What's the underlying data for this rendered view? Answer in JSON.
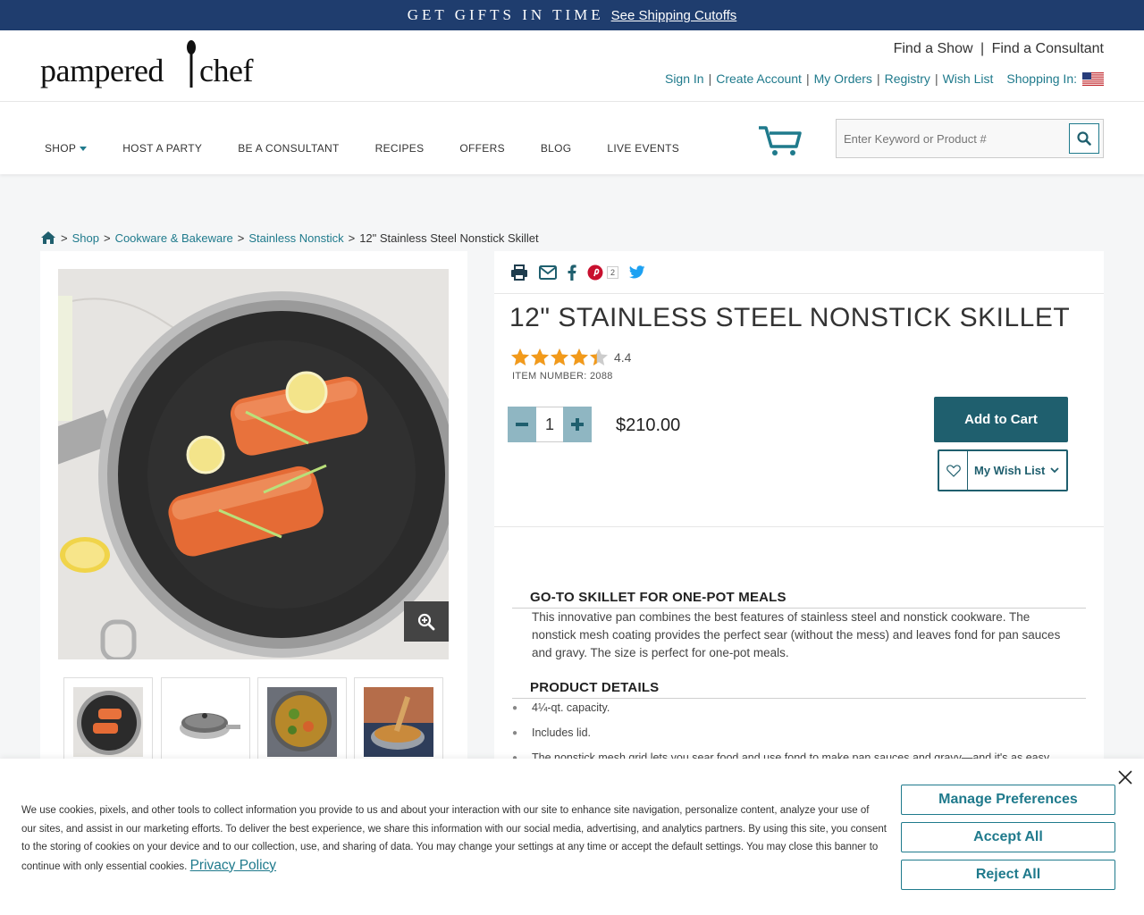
{
  "promo": {
    "headline": "GET GIFTS IN TIME",
    "link": "See Shipping Cutoffs"
  },
  "brand": {
    "logo_left": "pampered",
    "logo_right": "chef"
  },
  "header": {
    "find_show": "Find a Show",
    "find_consultant": "Find a Consultant",
    "sep": "|",
    "account_links": [
      "Sign In",
      "Create Account",
      "My Orders",
      "Registry",
      "Wish List"
    ],
    "shopping_in": "Shopping In:"
  },
  "nav": {
    "items": [
      "SHOP",
      "HOST A PARTY",
      "BE A CONSULTANT",
      "RECIPES",
      "OFFERS",
      "BLOG",
      "LIVE EVENTS"
    ]
  },
  "search": {
    "placeholder": "Enter Keyword or Product #"
  },
  "breadcrumb": {
    "sep": ">",
    "items": [
      "Shop",
      "Cookware & Bakeware",
      "Stainless Nonstick"
    ],
    "current": "12\" Stainless Steel Nonstick Skillet"
  },
  "product": {
    "title": "12\" STAINLESS STEEL NONSTICK SKILLET",
    "rating": "4.4",
    "rating_value": 4.4,
    "item_number": "ITEM NUMBER: 2088",
    "quantity": "1",
    "price": "$210.00",
    "add_to_cart": "Add to Cart",
    "wish_list": "My Wish List",
    "pin_count": "2"
  },
  "sections": {
    "goto_title": "GO-TO SKILLET FOR ONE-POT MEALS",
    "goto_text": "This innovative pan combines the best features of stainless steel and nonstick cookware. The nonstick mesh coating provides the perfect sear (without the mess) and leaves fond for pan sauces and gravy. The size is perfect for one-pot meals.",
    "details_title": "PRODUCT DETAILS",
    "details": [
      "4¼-qt. capacity.",
      "Includes lid.",
      "The nonstick mesh grid lets you sear food and use fond to make pan sauces and gravy—and it's as easy"
    ]
  },
  "cookie": {
    "text": "We use cookies, pixels, and other tools to collect information you provide to us and about your interaction with our site to enhance site navigation, personalize content, analyze your use of our sites, and assist in our marketing efforts. To deliver the best experience, we share this information with our social media, advertising, and analytics partners. By using this site, you consent to the storing of cookies on your device and to our collection, use, and sharing of data. You may change your settings at any time or accept the default settings. You may close this banner to continue with only essential cookies.",
    "privacy_link": "Privacy Policy",
    "manage": "Manage Preferences",
    "accept": "Accept All",
    "reject": "Reject All"
  },
  "colors": {
    "promo_bg": "#1f3d6e",
    "teal": "#1f7a8c",
    "button_dark": "#1f5f6e",
    "star": "#f29a1b"
  }
}
